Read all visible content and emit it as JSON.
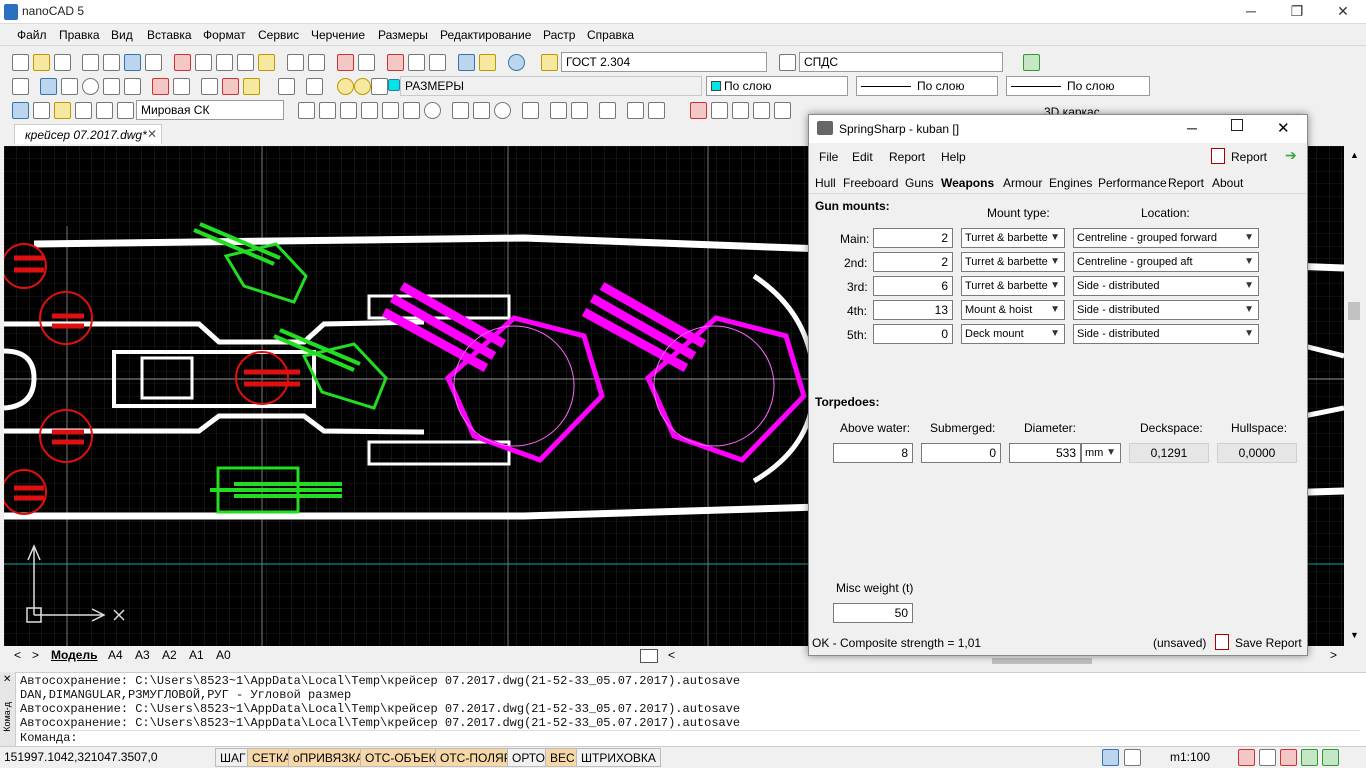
{
  "app": {
    "title": "nanoCAD 5"
  },
  "menu": [
    "Файл",
    "Правка",
    "Вид",
    "Вставка",
    "Формат",
    "Сервис",
    "Черчение",
    "Размеры",
    "Редактирование",
    "Растр",
    "Справка"
  ],
  "toolbar": {
    "style_combo": "ГОСТ 2.304",
    "spds_combo": "СПДС",
    "view_mode": "3D каркас",
    "layer_combo": "РАЗМЕРЫ",
    "color_combo": "По слою",
    "linetype_combo": "По слою",
    "lineweight_combo": "По слою",
    "ucs_combo": "Мировая СК"
  },
  "document_tab": {
    "name": "крейсер 07.2017.dwg*",
    "close": "✕"
  },
  "layout_tabs": [
    "Модель",
    "A4",
    "A3",
    "A2",
    "A1",
    "A0"
  ],
  "command_history": [
    "Автосохранение: C:\\Users\\8523~1\\AppData\\Local\\Temp\\крейсер 07.2017.dwg(21-52-33_05.07.2017).autosave",
    "DAN,DIMANGULAR,РЗМУГЛОВОЙ,РУГ - Угловой размер",
    "Автосохранение: C:\\Users\\8523~1\\AppData\\Local\\Temp\\крейсер 07.2017.dwg(21-52-33_05.07.2017).autosave",
    "Автосохранение: C:\\Users\\8523~1\\AppData\\Local\\Temp\\крейсер 07.2017.dwg(21-52-33_05.07.2017).autosave"
  ],
  "command_prompt": "Команда:",
  "command_side_label": "Кома-д",
  "status": {
    "coords": "151997.1042,321047.3507,0",
    "buttons": [
      {
        "label": "ШАГ",
        "on": false
      },
      {
        "label": "СЕТКА",
        "on": true
      },
      {
        "label": "оПРИВЯЗКА",
        "on": true
      },
      {
        "label": "ОТС-ОБЪЕКТ",
        "on": true
      },
      {
        "label": "ОТС-ПОЛЯР",
        "on": true
      },
      {
        "label": "ОРТО",
        "on": false
      },
      {
        "label": "ВЕС",
        "on": true
      },
      {
        "label": "ШТРИХОВКА",
        "on": false
      }
    ],
    "scale": "m1:100"
  },
  "dialog": {
    "title": "SpringSharp - kuban []",
    "menu": [
      "File",
      "Edit",
      "Report",
      "Help"
    ],
    "report_button": "Report",
    "tabs": [
      "Hull",
      "Freeboard",
      "Guns",
      "Weapons",
      "Armour",
      "Engines",
      "Performance",
      "Report",
      "About"
    ],
    "active_tab": "Weapons",
    "gun_mounts": {
      "heading": "Gun mounts:",
      "col_mount": "Mount type:",
      "col_location": "Location:",
      "rows": [
        {
          "label": "Main:",
          "count": "2",
          "mount": "Turret & barbette",
          "location": "Centreline - grouped forward"
        },
        {
          "label": "2nd:",
          "count": "2",
          "mount": "Turret & barbette",
          "location": "Centreline - grouped aft"
        },
        {
          "label": "3rd:",
          "count": "6",
          "mount": "Turret & barbette",
          "location": "Side - distributed"
        },
        {
          "label": "4th:",
          "count": "13",
          "mount": "Mount & hoist",
          "location": "Side - distributed"
        },
        {
          "label": "5th:",
          "count": "0",
          "mount": "Deck mount",
          "location": "Side - distributed"
        }
      ]
    },
    "torpedoes": {
      "heading": "Torpedoes:",
      "above_water_label": "Above water:",
      "submerged_label": "Submerged:",
      "diameter_label": "Diameter:",
      "deckspace_label": "Deckspace:",
      "hullspace_label": "Hullspace:",
      "above_water": "8",
      "submerged": "0",
      "diameter": "533",
      "unit": "mm",
      "deckspace": "0,1291",
      "hullspace": "0,0000"
    },
    "misc_weight_label": "Misc weight (t)",
    "misc_weight": "50",
    "status_text": "OK - Composite strength = 1,01",
    "unsaved": "(unsaved)",
    "save_report": "Save Report"
  },
  "colors": {
    "magenta": "#ff00ff",
    "green": "#22dd22",
    "red": "#e01010",
    "accent": "#f6d7a8"
  }
}
